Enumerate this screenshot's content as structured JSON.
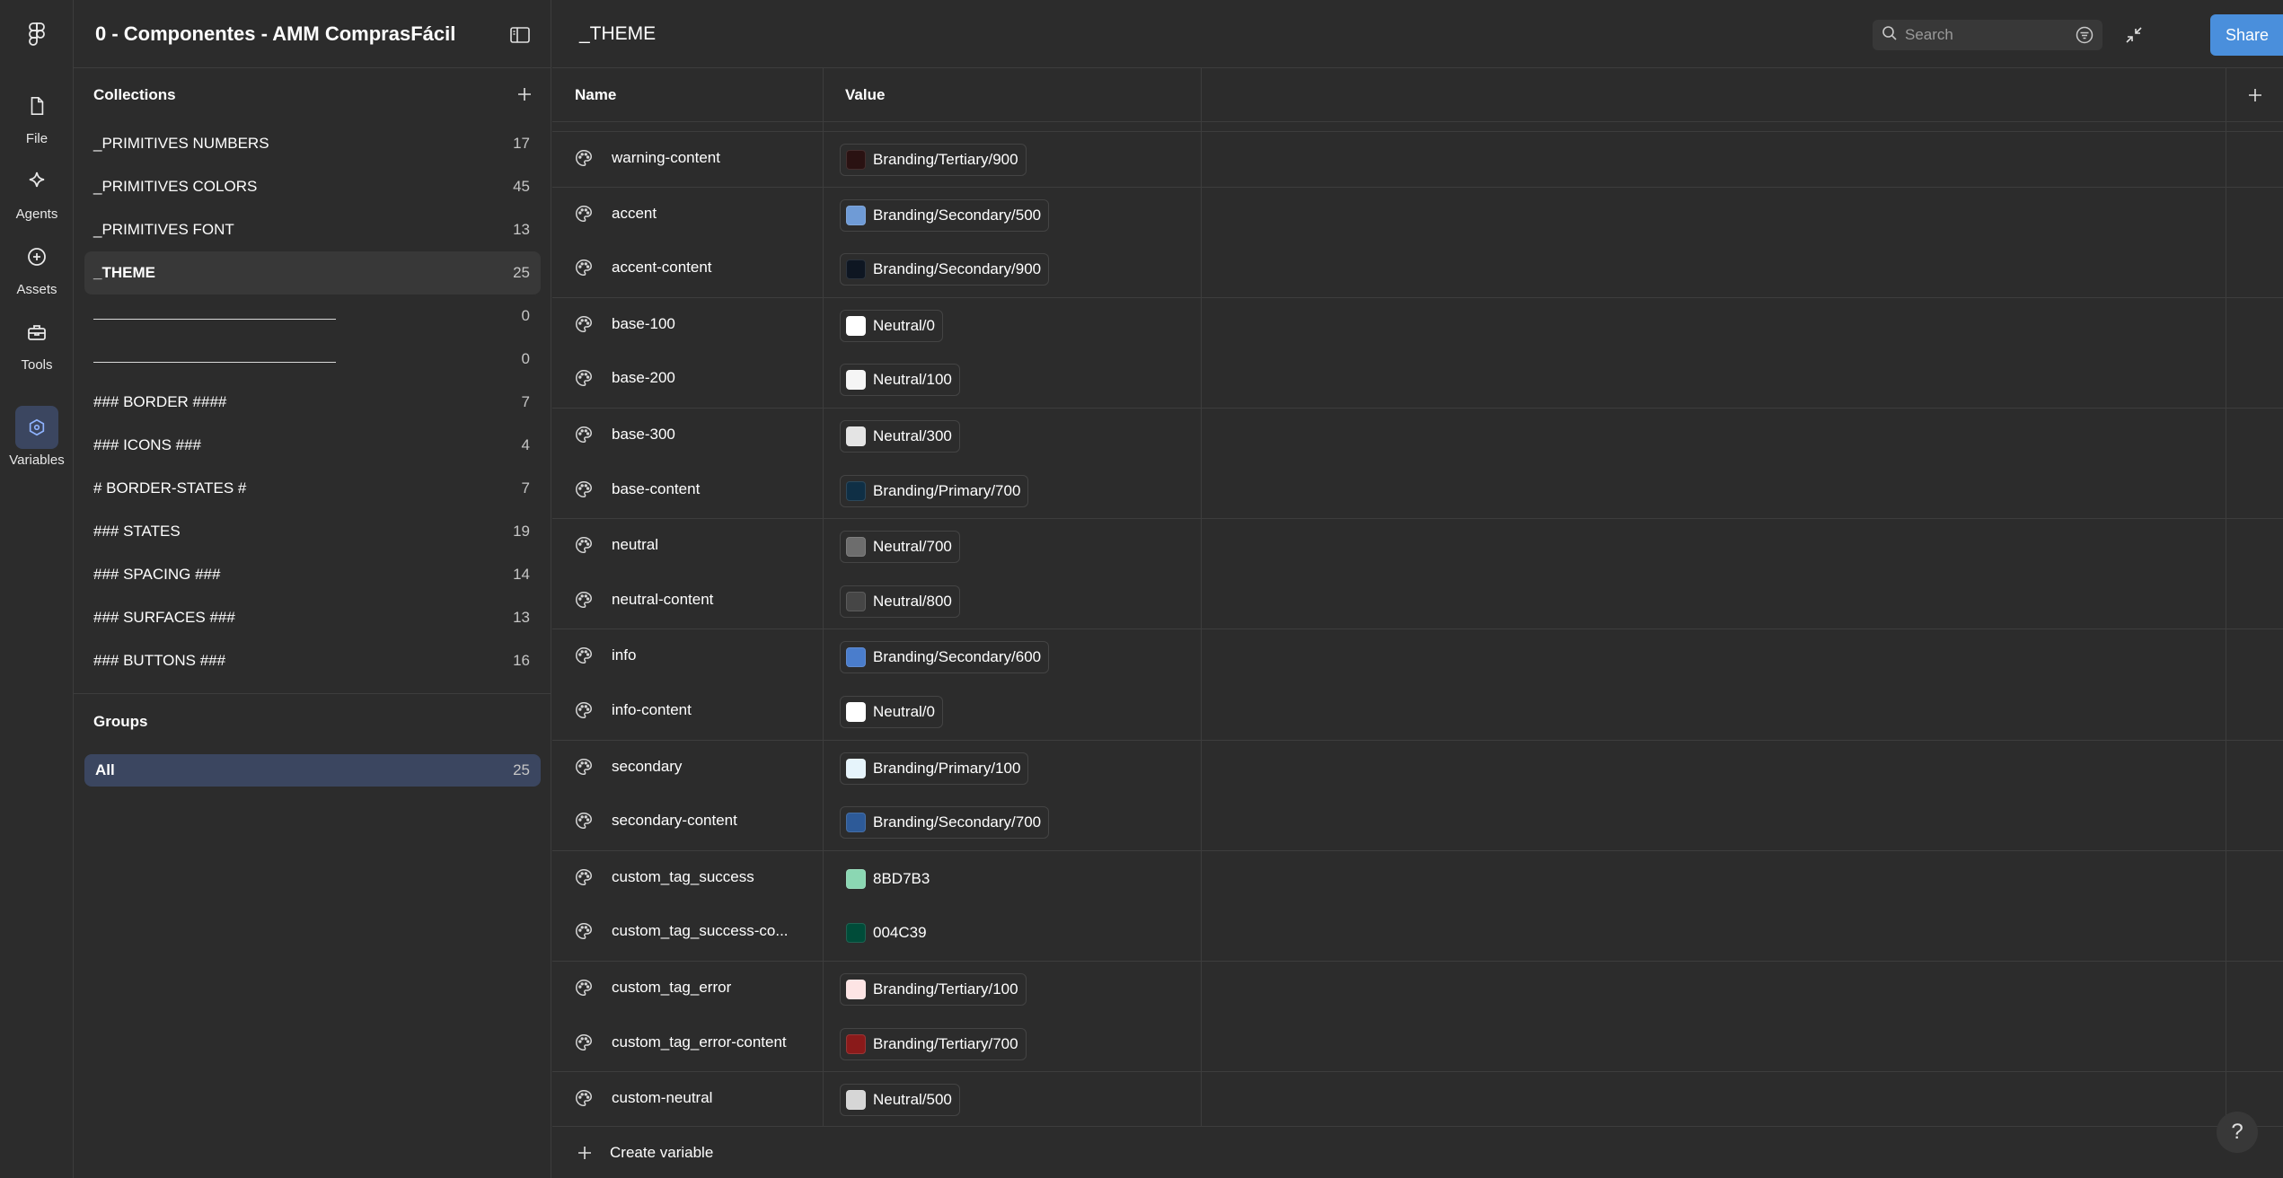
{
  "rail": {
    "items": [
      {
        "label": "File",
        "icon": "file-icon"
      },
      {
        "label": "Agents",
        "icon": "sparkle-icon"
      },
      {
        "label": "Assets",
        "icon": "assets-icon"
      },
      {
        "label": "Tools",
        "icon": "toolbox-icon"
      },
      {
        "label": "Variables",
        "icon": "variables-icon"
      }
    ]
  },
  "sidebar": {
    "title": "0 - Componentes - AMM ComprasFácil",
    "collections_title": "Collections",
    "collections": [
      {
        "label": "_PRIMITIVES NUMBERS",
        "count": "17"
      },
      {
        "label": "_PRIMITIVES COLORS",
        "count": "45"
      },
      {
        "label": "_PRIMITIVES FONT",
        "count": "13"
      },
      {
        "label": "_THEME",
        "count": "25"
      },
      {
        "label": "",
        "count": "0"
      },
      {
        "label": "",
        "count": "0"
      },
      {
        "label": "### BORDER ####",
        "count": "7"
      },
      {
        "label": "### ICONS ###",
        "count": "4"
      },
      {
        "label": "# BORDER-STATES #",
        "count": "7"
      },
      {
        "label": "### STATES",
        "count": "19"
      },
      {
        "label": "### SPACING ###",
        "count": "14"
      },
      {
        "label": "### SURFACES ###",
        "count": "13"
      },
      {
        "label": "### BUTTONS ###",
        "count": "16"
      }
    ],
    "groups_title": "Groups",
    "groups": [
      {
        "label": "All",
        "count": "25"
      }
    ]
  },
  "main": {
    "title": "_THEME",
    "search_placeholder": "Search",
    "share_label": "Share",
    "col_name": "Name",
    "col_value": "Value",
    "create_label": "Create variable",
    "help_label": "?",
    "variables": [
      {
        "name": "warning-content",
        "value": "Branding/Tertiary/900",
        "swatch": "#2a1212",
        "alias": true
      },
      {
        "name": "accent",
        "value": "Branding/Secondary/500",
        "swatch": "#6f9bd6",
        "alias": true
      },
      {
        "name": "accent-content",
        "value": "Branding/Secondary/900",
        "swatch": "#0e1622",
        "alias": true
      },
      {
        "name": "base-100",
        "value": "Neutral/0",
        "swatch": "#ffffff",
        "alias": true
      },
      {
        "name": "base-200",
        "value": "Neutral/100",
        "swatch": "#f5f5f5",
        "alias": true
      },
      {
        "name": "base-300",
        "value": "Neutral/300",
        "swatch": "#e4e4e4",
        "alias": true
      },
      {
        "name": "base-content",
        "value": "Branding/Primary/700",
        "swatch": "#0f2f45",
        "alias": true
      },
      {
        "name": "neutral",
        "value": "Neutral/700",
        "swatch": "#6d6d6d",
        "alias": true
      },
      {
        "name": "neutral-content",
        "value": "Neutral/800",
        "swatch": "#464646",
        "alias": true
      },
      {
        "name": "info",
        "value": "Branding/Secondary/600",
        "swatch": "#4a7dcc",
        "alias": true
      },
      {
        "name": "info-content",
        "value": "Neutral/0",
        "swatch": "#ffffff",
        "alias": true
      },
      {
        "name": "secondary",
        "value": "Branding/Primary/100",
        "swatch": "#e6f4fb",
        "alias": true
      },
      {
        "name": "secondary-content",
        "value": "Branding/Secondary/700",
        "swatch": "#2d5a98",
        "alias": true
      },
      {
        "name": "custom_tag_success",
        "value": "8BD7B3",
        "swatch": "#8bd7b3",
        "alias": false
      },
      {
        "name": "custom_tag_success-co...",
        "value": "004C39",
        "swatch": "#004c39",
        "alias": false
      },
      {
        "name": "custom_tag_error",
        "value": "Branding/Tertiary/100",
        "swatch": "#fde4e4",
        "alias": true
      },
      {
        "name": "custom_tag_error-content",
        "value": "Branding/Tertiary/700",
        "swatch": "#8a1a1a",
        "alias": true
      },
      {
        "name": "custom-neutral",
        "value": "Neutral/500",
        "swatch": "#d6d6d6",
        "alias": true
      }
    ]
  },
  "colors": {
    "accent": "#4a8fdc",
    "active_nav": "#3b4660",
    "background": "#2c2c2c",
    "border": "#3d3d3d"
  }
}
